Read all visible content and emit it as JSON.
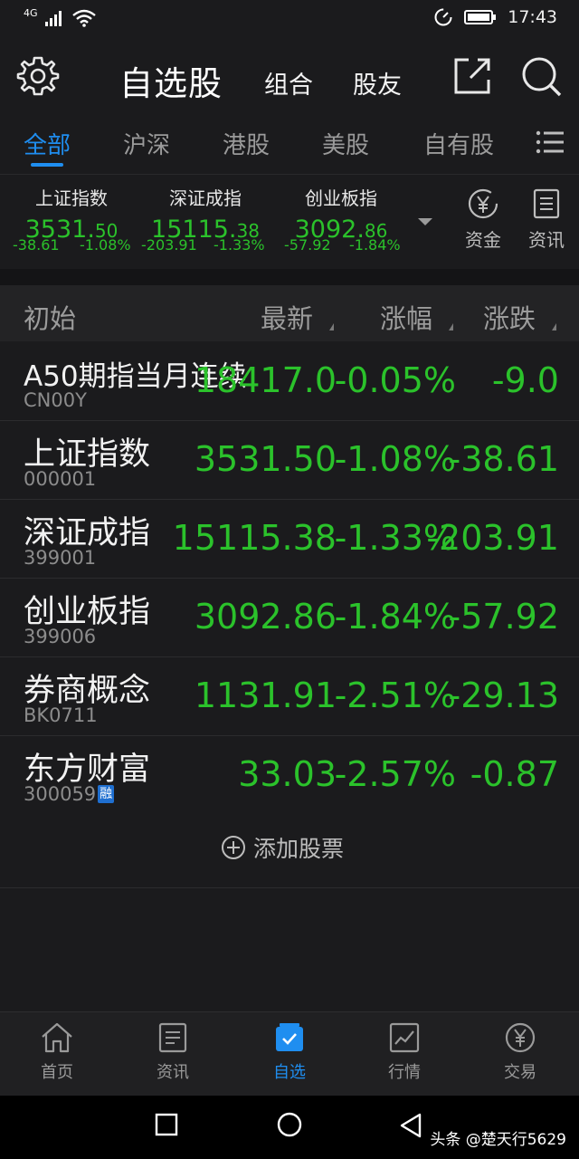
{
  "status_bar": {
    "network": "4G",
    "time": "17:43"
  },
  "header": {
    "title": "自选股",
    "link1": "组合",
    "link2": "股友"
  },
  "tabs": [
    {
      "label": "全部",
      "active": true
    },
    {
      "label": "沪深",
      "active": false
    },
    {
      "label": "港股",
      "active": false
    },
    {
      "label": "美股",
      "active": false
    },
    {
      "label": "自有股",
      "active": false
    }
  ],
  "indices": [
    {
      "name": "上证指数",
      "value_int": "3531.",
      "value_dec": "50",
      "change": "-38.61",
      "pct": "-1.08%"
    },
    {
      "name": "深证成指",
      "value_int": "15115.",
      "value_dec": "38",
      "change": "-203.91",
      "pct": "-1.33%"
    },
    {
      "name": "创业板指",
      "value_int": "3092.",
      "value_dec": "86",
      "change": "-57.92",
      "pct": "-1.84%"
    }
  ],
  "side_buttons": {
    "funds": "资金",
    "news": "资讯"
  },
  "columns": {
    "name": "初始",
    "latest": "最新",
    "pct": "涨幅",
    "change": "涨跌"
  },
  "stocks": [
    {
      "name": "A50期指当月连续",
      "code": "CN00Y",
      "price": "18417.0",
      "pct": "-0.05%",
      "change": "-9.0"
    },
    {
      "name": "上证指数",
      "code": "000001",
      "price": "3531.50",
      "pct": "-1.08%",
      "change": "-38.61"
    },
    {
      "name": "深证成指",
      "code": "399001",
      "price": "15115.38",
      "pct": "-1.33%",
      "change": "-203.91"
    },
    {
      "name": "创业板指",
      "code": "399006",
      "price": "3092.86",
      "pct": "-1.84%",
      "change": "-57.92"
    },
    {
      "name": "券商概念",
      "code": "BK0711",
      "price": "1131.91",
      "pct": "-2.51%",
      "change": "-29.13"
    },
    {
      "name": "东方财富",
      "code": "300059",
      "badge": "融",
      "price": "33.03",
      "pct": "-2.57%",
      "change": "-0.87"
    }
  ],
  "add_stock": "添加股票",
  "bottom_nav": [
    {
      "label": "首页",
      "icon": "home-icon",
      "active": false
    },
    {
      "label": "资讯",
      "icon": "news-icon",
      "active": false
    },
    {
      "label": "自选",
      "icon": "watchlist-icon",
      "active": true
    },
    {
      "label": "行情",
      "icon": "market-icon",
      "active": false
    },
    {
      "label": "交易",
      "icon": "trade-icon",
      "active": false
    }
  ],
  "watermark": "头条 @楚天行5629",
  "colors": {
    "accent": "#1f8ef0",
    "down": "#2bc22b",
    "background": "#1b1b1d"
  }
}
